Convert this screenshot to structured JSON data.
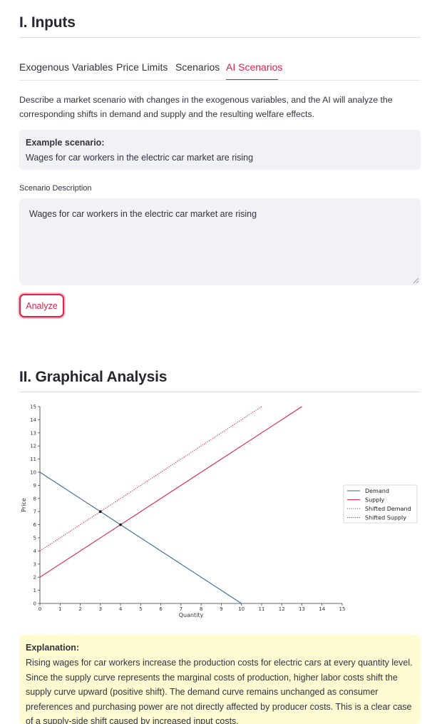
{
  "inputs": {
    "heading": "I. Inputs"
  },
  "tabs": [
    {
      "label": "Exogenous Variables",
      "active": false
    },
    {
      "label": "Price Limits",
      "active": false
    },
    {
      "label": "Scenarios",
      "active": false
    },
    {
      "label": "AI Scenarios",
      "active": true
    }
  ],
  "ai": {
    "description": "Describe a market scenario with changes in the exogenous variables, and the AI will analyze the corresponding shifts in demand and supply and the resulting welfare effects.",
    "example_title": "Example scenario:",
    "example_text": "Wages for car workers in the electric car market are rising",
    "field_label": "Scenario Description",
    "field_value": "Wages for car workers in the electric car market are rising",
    "button_label": "Analyze"
  },
  "graph": {
    "heading": "II. Graphical Analysis"
  },
  "colors": {
    "accent": "#e0214a",
    "demand": "#3b6a9a",
    "supply": "#e0214a"
  },
  "chart_data": {
    "type": "line",
    "xlabel": "Quantity",
    "ylabel": "Price",
    "xlim": [
      0,
      15
    ],
    "ylim": [
      0,
      15
    ],
    "xticks": [
      0,
      1,
      2,
      3,
      4,
      5,
      6,
      7,
      8,
      9,
      10,
      11,
      12,
      13,
      14,
      15
    ],
    "yticks": [
      0,
      1,
      2,
      3,
      4,
      5,
      6,
      7,
      8,
      9,
      10,
      11,
      12,
      13,
      14,
      15
    ],
    "legend_position": "right",
    "series": [
      {
        "name": "Demand",
        "style": "solid",
        "color": "#3b6a9a",
        "points": [
          [
            0,
            10
          ],
          [
            10,
            0
          ]
        ]
      },
      {
        "name": "Supply",
        "style": "solid",
        "color": "#e0214a",
        "points": [
          [
            0,
            2
          ],
          [
            13,
            15
          ]
        ]
      },
      {
        "name": "Shifted Demand",
        "style": "dotted",
        "color": "#3b6a9a",
        "points": []
      },
      {
        "name": "Shifted Supply",
        "style": "dotted",
        "color": "#e0214a",
        "points": [
          [
            0,
            4
          ],
          [
            11,
            15
          ]
        ]
      }
    ],
    "equilibria": [
      [
        4,
        6
      ],
      [
        3,
        7
      ]
    ]
  },
  "explanation": {
    "title": "Explanation:",
    "text": "Rising wages for car workers increase the production costs for electric cars at every quantity level. Since the supply curve represents the marginal costs of production, higher labor costs shift the supply curve upward (positive shift). The demand curve remains unchanged as consumer preferences and purchasing power are not directly affected by producer costs. This is a clear case of a supply-side shift caused by increased input costs."
  }
}
